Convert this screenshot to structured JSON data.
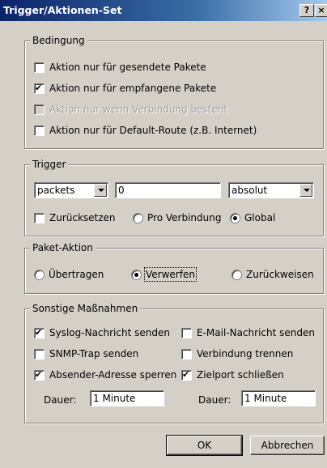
{
  "window": {
    "title": "Trigger/Aktionen-Set",
    "help_label": "?",
    "close_label": "×"
  },
  "bedingung": {
    "legend": "Bedingung",
    "items": [
      {
        "label": "Aktion nur für gesendete Pakete",
        "checked": false,
        "disabled": false
      },
      {
        "label": "Aktion nur für empfangene Pakete",
        "checked": true,
        "disabled": false
      },
      {
        "label": "Aktion nur wenn Verbindung besteht",
        "checked": false,
        "disabled": true
      },
      {
        "label": "Aktion nur für Default-Route (z.B. Internet)",
        "checked": false,
        "disabled": false
      }
    ]
  },
  "trigger": {
    "legend": "Trigger",
    "type_value": "packets",
    "count_value": "0",
    "mode_value": "absolut",
    "reset_label": "Zurücksetzen",
    "reset_checked": false,
    "per_connection_label": "Pro Verbindung",
    "global_label": "Global",
    "selected_scope": "Global"
  },
  "paket_aktion": {
    "legend": "Paket-Aktion",
    "options": [
      "Übertragen",
      "Verwerfen",
      "Zurückweisen"
    ],
    "selected": "Verwerfen"
  },
  "sonstige": {
    "legend": "Sonstige Maßnahmen",
    "syslog_label": "Syslog-Nachricht senden",
    "syslog_checked": true,
    "email_label": "E-Mail-Nachricht senden",
    "email_checked": false,
    "snmp_label": "SNMP-Trap senden",
    "snmp_checked": false,
    "disconnect_label": "Verbindung trennen",
    "disconnect_checked": false,
    "block_sender_label": "Absender-Adresse sperren",
    "block_sender_checked": true,
    "close_port_label": "Zielport schließen",
    "close_port_checked": true,
    "duration_label_left": "Dauer:",
    "duration_value_left": "1 Minute",
    "duration_label_right": "Dauer:",
    "duration_value_right": "1 Minute"
  },
  "buttons": {
    "ok_label": "OK",
    "cancel_label": "Abbrechen"
  }
}
